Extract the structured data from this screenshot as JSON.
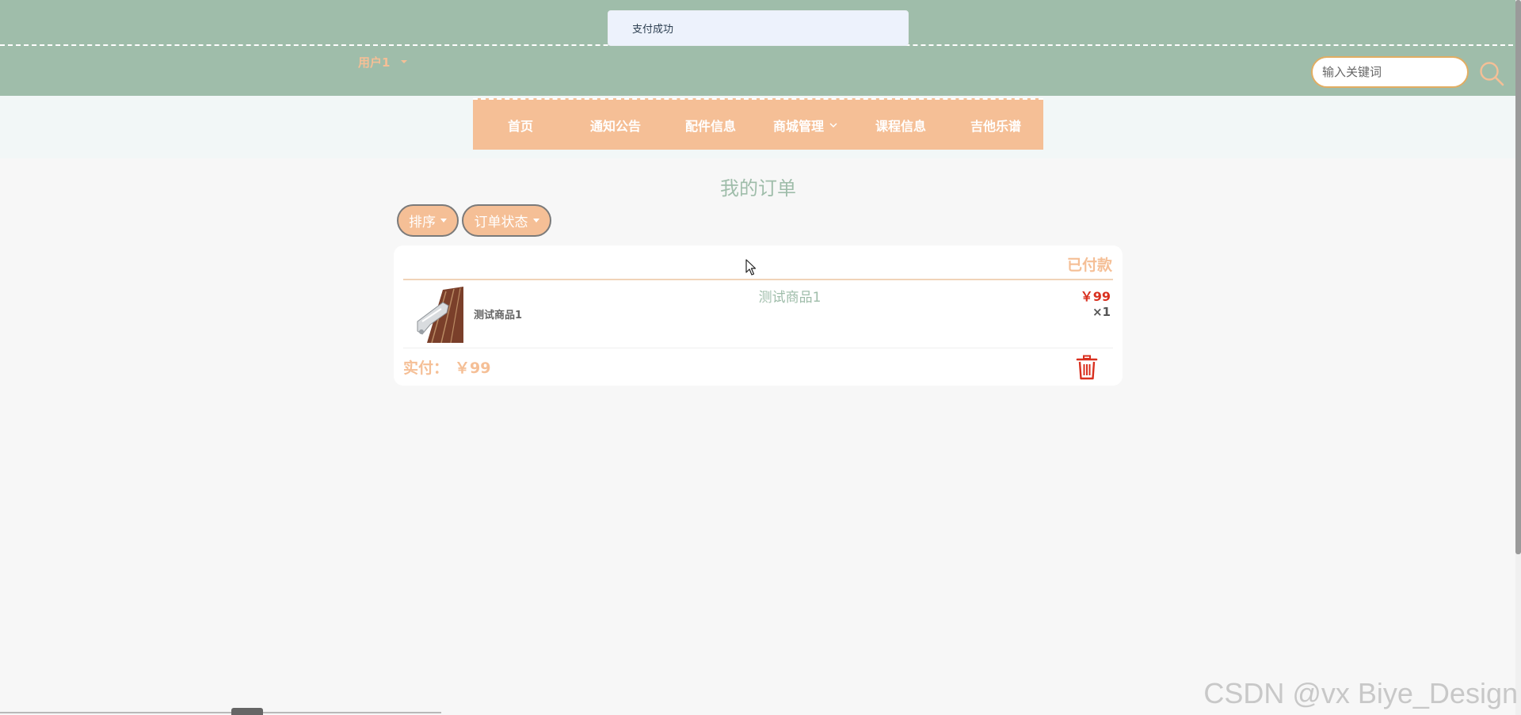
{
  "toast": {
    "message": "支付成功"
  },
  "header": {
    "user_label": "用户1",
    "search_placeholder": "输入关键词"
  },
  "nav": {
    "items": [
      {
        "label": "首页"
      },
      {
        "label": "通知公告"
      },
      {
        "label": "配件信息"
      },
      {
        "label": "商城管理",
        "has_dropdown": true
      },
      {
        "label": "课程信息"
      },
      {
        "label": "吉他乐谱"
      }
    ]
  },
  "page": {
    "title": "我的订单",
    "sort_label": "排序",
    "status_filter_label": "订单状态"
  },
  "orders": [
    {
      "status": "已付款",
      "items": [
        {
          "name": "测试商品1",
          "title": "测试商品1",
          "price": "￥99",
          "quantity": "×1"
        }
      ],
      "paid_label": "实付：",
      "paid_amount": "￥99"
    }
  ],
  "watermark": "CSDN @vx Biye_Design",
  "colors": {
    "header_bg": "#9fbdaa",
    "accent_orange": "#f5bf96",
    "price_red": "#d9301f",
    "delete_red": "#d9301f"
  },
  "icons": {
    "search": "search-icon",
    "trash": "trash-icon",
    "user_caret": "caret-down-icon",
    "nav_chevron": "chevron-down-icon"
  }
}
